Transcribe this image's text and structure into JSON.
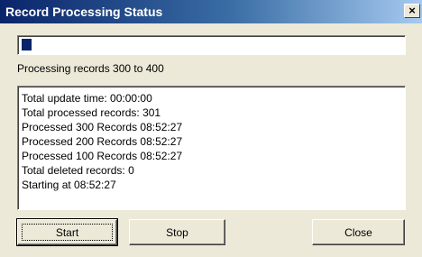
{
  "window": {
    "title": "Record Processing Status",
    "close_glyph": "×"
  },
  "progress": {
    "fraction": 0.025
  },
  "status_text": "Processing records 300 to 400",
  "log": [
    "Total update time: 00:00:00",
    "Total processed records: 301",
    "Processed 300 Records 08:52:27",
    "Processed 200 Records 08:52:27",
    "Processed 100 Records 08:52:27",
    "Total deleted records: 0",
    "Starting at 08:52:27"
  ],
  "buttons": {
    "start": "Start",
    "stop": "Stop",
    "close": "Close"
  },
  "colors": {
    "title_start": "#0a246a",
    "title_end": "#a6caf0",
    "progress_fill": "#0a246a",
    "face": "#ece9d8"
  }
}
